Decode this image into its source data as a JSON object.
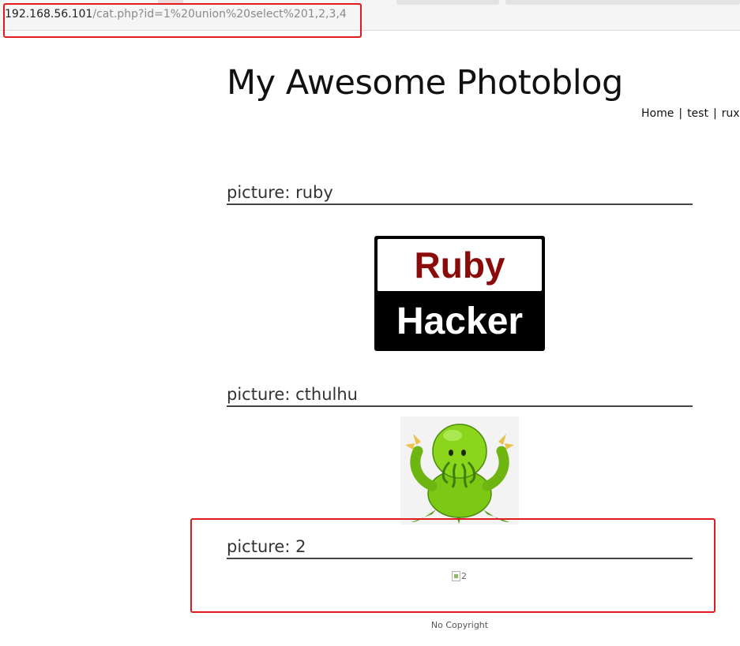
{
  "browser": {
    "url_host": "192.168.56.101",
    "url_path": "/cat.php?id=1%20union%20select%201,2,3,4"
  },
  "site": {
    "title": "My Awesome Photoblog",
    "nav": [
      "Home",
      "test",
      "rux"
    ]
  },
  "posts": [
    {
      "prefix": "picture: ",
      "name": "ruby",
      "image": {
        "line1": "Ruby",
        "line2": "Hacker"
      }
    },
    {
      "prefix": "picture: ",
      "name": "cthulhu",
      "image_icon": "cthulhu-illustration"
    },
    {
      "prefix": "picture: ",
      "name": "2",
      "image_alt": "2"
    }
  ],
  "footer": "No Copyright",
  "colors": {
    "highlight": "#e11b1b",
    "ruby_red": "#8b0a0a",
    "cthulhu_green": "#7cc814"
  }
}
